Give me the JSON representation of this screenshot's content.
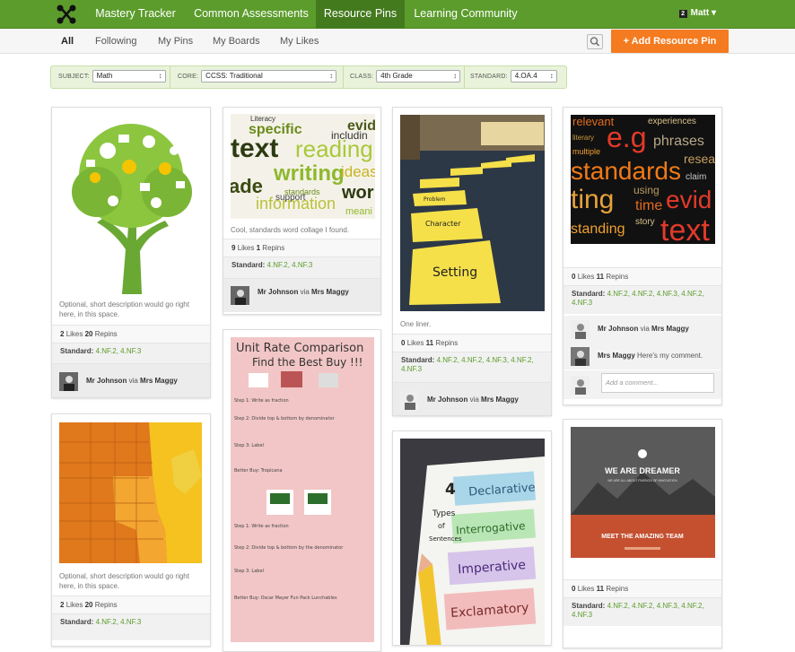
{
  "topnav": {
    "items": [
      "Mastery Tracker",
      "Common Assessments",
      "Resource Pins",
      "Learning Community"
    ],
    "active": "Resource Pins",
    "user": {
      "badge": "2",
      "name": "Matt"
    },
    "logo_icon": "network-logo-icon",
    "accent": "#5c9c2c",
    "accent_dark": "#447a1e"
  },
  "subnav": {
    "tabs": [
      "All",
      "Following",
      "My Pins",
      "My Boards",
      "My Likes"
    ],
    "active": "All",
    "search_icon": "search-icon",
    "add_button": "+ Add Resource Pin",
    "add_color": "#f47b20"
  },
  "filters": [
    {
      "label": "SUBJECT:",
      "value": "Math"
    },
    {
      "label": "CORE:",
      "value": "CCSS: Traditional"
    },
    {
      "label": "CLASS:",
      "value": "4th Grade"
    },
    {
      "label": "STANDARD:",
      "value": "4.OA.4"
    }
  ],
  "cards": {
    "tree": {
      "description": "Optional, short description would go right here, in this space.",
      "likes": "2",
      "likes_word": "Likes",
      "repins": "20",
      "repins_word": "Repins",
      "standard_label": "Standard:",
      "standards": "4.NF.2, 4.NF.3",
      "author": "Mr Johnson",
      "via": "via",
      "source": "Mrs Maggy"
    },
    "wordcollage": {
      "words": [
        "text",
        "reading",
        "specific",
        "evid",
        "writing",
        "ideas",
        "wor",
        "information",
        "includin",
        "standards",
        "Literacy",
        "support",
        "meani",
        "ade"
      ],
      "description": "Cool, standards word collage I found.",
      "likes": "9",
      "likes_word": "Likes",
      "repins": "1",
      "repins_word": "Repins",
      "standard_label": "Standard:",
      "standards": "4.NF.2, 4.NF.3",
      "author": "Mr Johnson",
      "via": "via",
      "source": "Mrs Maggy"
    },
    "setting": {
      "signs": [
        "Problem",
        "Character",
        "Setting"
      ],
      "description": "One liner.",
      "likes": "0",
      "likes_word": "Likes",
      "repins": "11",
      "repins_word": "Repins",
      "standard_label": "Standard:",
      "standards": "4.NF.2, 4.NF.2, 4.NF.3, 4.NF.2, 4.NF.3",
      "author": "Mr Johnson",
      "via": "via",
      "source": "Mrs Maggy"
    },
    "wordcloud": {
      "words": [
        "relevant",
        "e.g",
        "experiences",
        "literary",
        "phrases",
        "multiple",
        "standards",
        "research",
        "ting",
        "using",
        "evid",
        "time",
        "claim",
        "standing",
        "story",
        "text"
      ],
      "likes": "0",
      "likes_word": "Likes",
      "repins": "11",
      "repins_word": "Repins",
      "standard_label": "Standard:",
      "standards": "4.NF.2, 4.NF.2, 4.NF.3, 4.NF.2, 4.NF.3",
      "author": "Mr Johnson",
      "via": "via",
      "source": "Mrs Maggy",
      "comment_author": "Mrs Maggy",
      "comment": "Here's my comment.",
      "comment_placeholder": "Add a comment..."
    },
    "map": {
      "description": "Optional, short description would go right here, in this space.",
      "likes": "2",
      "likes_word": "Likes",
      "repins": "20",
      "repins_word": "Repins",
      "standard_label": "Standard:",
      "standards": "4.NF.2, 4.NF.3"
    },
    "unitrate": {
      "title1": "Unit Rate Comparison",
      "title2": "Find the Best Buy !!!",
      "steps": [
        "Step 1: Write as fraction",
        "Step 2: Divide top & bottom by denominator",
        "Step 3: Label",
        "Better Buy: Tropicana",
        "Step 1: Write as fraction",
        "Step 2: Divide top & bottom by the denominator",
        "Step 3: Label",
        "Better Buy: Oscar Mayer Fun Pack Lunchables"
      ]
    },
    "sentences": {
      "words": [
        "4",
        "Types",
        "of",
        "Sentences",
        "Declarative",
        "Interrogative",
        "Imperative",
        "Exclamatory"
      ]
    },
    "dreamer": {
      "headline": "WE ARE DREAMER",
      "tagline": "WE ARE ALL ABOUT PASSION OF INNOVATION",
      "banner": "MEET THE AMAZING TEAM",
      "likes": "0",
      "likes_word": "Likes",
      "repins": "11",
      "repins_word": "Repins",
      "standard_label": "Standard:",
      "standards": "4.NF.2, 4.NF.2, 4.NF.3, 4.NF.2, 4.NF.3"
    }
  }
}
